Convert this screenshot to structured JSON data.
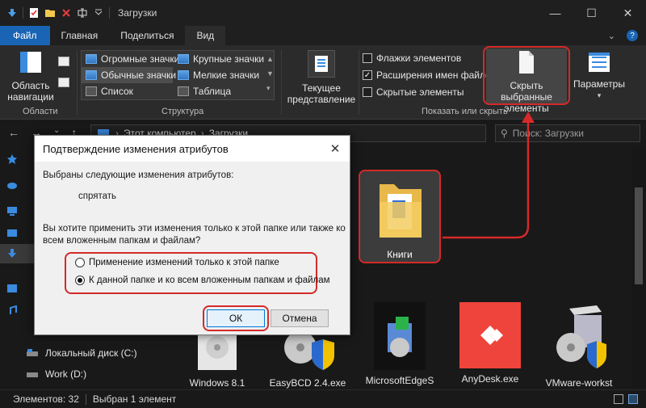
{
  "window": {
    "title": "Загрузки",
    "minimize": "—",
    "maximize": "☐",
    "close": "✕"
  },
  "tabs": [
    {
      "label": "Файл"
    },
    {
      "label": "Главная"
    },
    {
      "label": "Поделиться"
    },
    {
      "label": "Вид"
    }
  ],
  "ribbon": {
    "nav_area": {
      "line1": "Область",
      "line2": "навигации"
    },
    "group_panels": "Области",
    "layout": {
      "items": [
        "Огромные значки",
        "Крупные значки",
        "Обычные значки",
        "Мелкие значки",
        "Список",
        "Таблица"
      ],
      "selected": "Обычные значки"
    },
    "group_structure": "Структура",
    "current_view": {
      "line1": "Текущее",
      "line2": "представление"
    },
    "checkboxes": [
      {
        "label": "Флажки элементов",
        "checked": false
      },
      {
        "label": "Расширения имен файлов",
        "checked": true
      },
      {
        "label": "Скрытые элементы",
        "checked": false
      }
    ],
    "hide_selected": {
      "line1": "Скрыть выбранные",
      "line2": "элементы"
    },
    "params": "Параметры",
    "group_show": "Показать или скрыть"
  },
  "address": {
    "path": [
      "Этот компьютер",
      "Загрузки"
    ],
    "search_placeholder": "Поиск: Загрузки"
  },
  "sidebar": {
    "items": [
      {
        "label": "Локальный диск (C:)"
      },
      {
        "label": "Work (D:)"
      }
    ]
  },
  "files": [
    {
      "label": "Книги"
    },
    {
      "label": "Windows 8.1"
    },
    {
      "label": "EasyBCD 2.4.exe"
    },
    {
      "label": "MicrosoftEdgeS"
    },
    {
      "label": "AnyDesk.exe"
    },
    {
      "label": "VMware-workst"
    }
  ],
  "status": {
    "count": "Элементов: 32",
    "selected": "Выбран 1 элемент"
  },
  "dialog": {
    "title": "Подтверждение изменения атрибутов",
    "changes_label": "Выбраны следующие изменения атрибутов:",
    "change": "спрятать",
    "question_line1": "Вы хотите применить эти изменения только к этой папке или также ко",
    "question_line2": "всем вложенным папкам и файлам?",
    "option1": "Применение изменений только к этой папке",
    "option2": "К данной папке и ко всем вложенным папкам и файлам",
    "selected_option": 2,
    "ok": "ОК",
    "cancel": "Отмена"
  },
  "colors": {
    "accent": "#1964b4",
    "highlight": "#d42a2a",
    "dark_bg": "#191919",
    "ribbon_bg": "#2b2b2b"
  }
}
